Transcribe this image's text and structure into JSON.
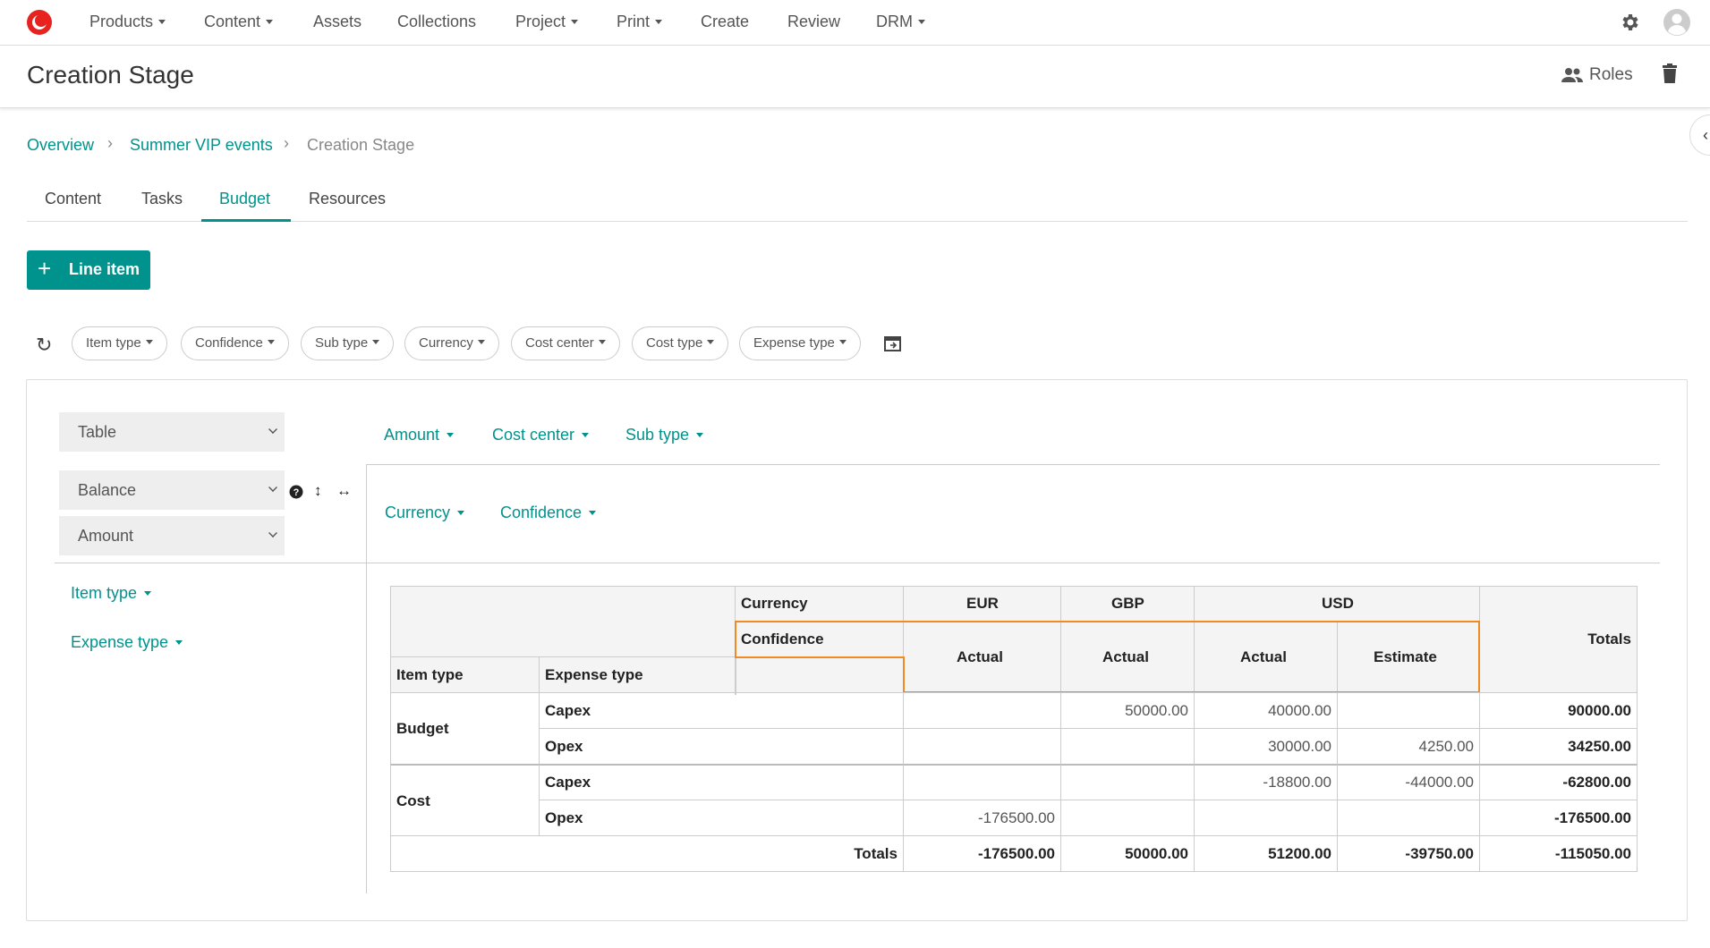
{
  "nav": {
    "items": [
      {
        "label": "Products",
        "dropdown": true
      },
      {
        "label": "Content",
        "dropdown": true
      },
      {
        "label": "Assets",
        "dropdown": false
      },
      {
        "label": "Collections",
        "dropdown": false
      },
      {
        "label": "Project",
        "dropdown": true
      },
      {
        "label": "Print",
        "dropdown": true
      },
      {
        "label": "Create",
        "dropdown": false
      },
      {
        "label": "Review",
        "dropdown": false
      },
      {
        "label": "DRM",
        "dropdown": true
      }
    ],
    "brand_color": "#e8231f"
  },
  "header": {
    "title": "Creation Stage",
    "roles_label": "Roles"
  },
  "breadcrumb": {
    "items": [
      "Overview",
      "Summer VIP events",
      "Creation Stage"
    ]
  },
  "tabs": {
    "items": [
      "Content",
      "Tasks",
      "Budget",
      "Resources"
    ],
    "active": "Budget"
  },
  "toolbar": {
    "add_label": "Line item"
  },
  "filters": [
    "Item type",
    "Confidence",
    "Sub type",
    "Currency",
    "Cost center",
    "Cost type",
    "Expense type"
  ],
  "pivot": {
    "view_select": "Table",
    "aggregate_select": "Balance",
    "value_select": "Amount",
    "row_fields_top": [
      "Amount",
      "Cost center",
      "Sub type"
    ],
    "column_fields": [
      "Currency",
      "Confidence"
    ],
    "row_fields": [
      "Item type",
      "Expense type"
    ]
  },
  "table": {
    "col_header_currency": "Currency",
    "col_header_confidence": "Confidence",
    "row_header_item_type": "Item type",
    "row_header_expense_type": "Expense type",
    "currencies": [
      "EUR",
      "GBP",
      "USD"
    ],
    "confidences": [
      "Actual",
      "Actual",
      "Actual",
      "Estimate"
    ],
    "totals_label": "Totals",
    "groups": [
      {
        "label": "Budget",
        "rows": [
          {
            "label": "Capex",
            "values": [
              "",
              "50000.00",
              "40000.00",
              ""
            ],
            "total": "90000.00"
          },
          {
            "label": "Opex",
            "values": [
              "",
              "",
              "30000.00",
              "4250.00"
            ],
            "total": "34250.00"
          }
        ]
      },
      {
        "label": "Cost",
        "rows": [
          {
            "label": "Capex",
            "values": [
              "",
              "",
              "-18800.00",
              "-44000.00"
            ],
            "total": "-62800.00"
          },
          {
            "label": "Opex",
            "values": [
              "-176500.00",
              "",
              "",
              ""
            ],
            "total": "-176500.00"
          }
        ]
      }
    ],
    "column_totals": [
      "-176500.00",
      "50000.00",
      "51200.00",
      "-39750.00"
    ],
    "grand_total": "-115050.00",
    "accent_color": "#00928d",
    "highlight_color": "#f08a24"
  }
}
